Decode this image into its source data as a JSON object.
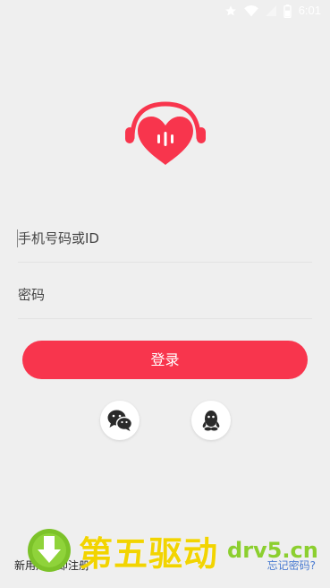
{
  "status_bar": {
    "time": "6:01",
    "icons": [
      "star-icon",
      "wifi-icon",
      "signal-icon",
      "battery-icon"
    ]
  },
  "brand": {
    "logo": "heart-headphones-icon",
    "accent_color": "#f8354d"
  },
  "login_form": {
    "phone_placeholder": "手机号码或ID",
    "password_placeholder": "密码",
    "login_label": "登录"
  },
  "social_login": [
    "wechat-icon",
    "qq-icon"
  ],
  "footer": {
    "register_text": "新用户立即注册",
    "forgot_link": "忘记密码?"
  },
  "watermark": {
    "title": "第五驱动",
    "domain": "drv5.cn"
  }
}
